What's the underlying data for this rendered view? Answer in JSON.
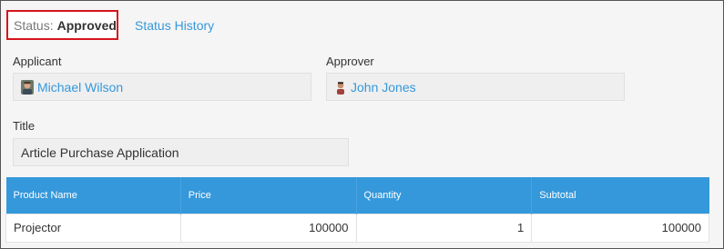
{
  "status": {
    "label": "Status:",
    "value": "Approved",
    "history_link": "Status History"
  },
  "applicant": {
    "label": "Applicant",
    "name": "Michael Wilson",
    "avatar_icon": "user-avatar-icon"
  },
  "approver": {
    "label": "Approver",
    "name": "John Jones",
    "avatar_icon": "user-avatar-icon"
  },
  "title_field": {
    "label": "Title",
    "value": "Article Purchase Application"
  },
  "table": {
    "headers": [
      "Product Name",
      "Price",
      "Quantity",
      "Subtotal"
    ],
    "rows": [
      [
        "Projector",
        "100000",
        "1",
        "100000"
      ]
    ]
  },
  "colors": {
    "accent": "#3498db",
    "highlight_border": "#d6141d"
  }
}
